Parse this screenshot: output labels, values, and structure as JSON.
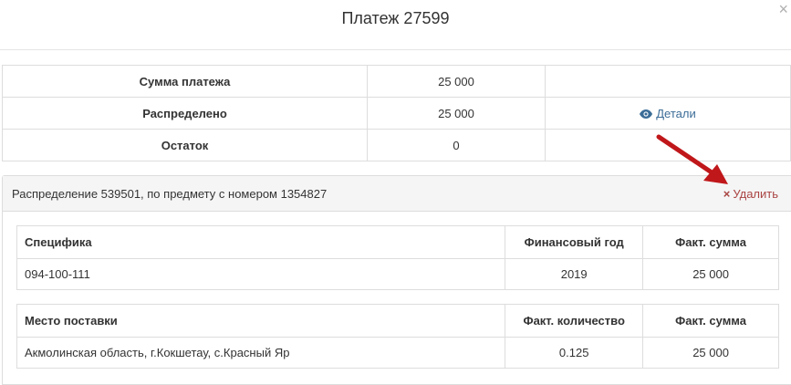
{
  "modal": {
    "title": "Платеж 27599",
    "close": "×"
  },
  "summary": {
    "rows": [
      {
        "label": "Сумма платежа",
        "value": "25 000",
        "extra": ""
      },
      {
        "label": "Распределено",
        "value": "25 000",
        "extra": "Детали"
      },
      {
        "label": "Остаток",
        "value": "0",
        "extra": ""
      }
    ]
  },
  "distribution": {
    "title": "Распределение 539501, по предмету с номером 1354827",
    "delete_label": "Удалить",
    "delete_icon": "×",
    "spec_table": {
      "headers": [
        "Специфика",
        "Финансовый год",
        "Факт. сумма"
      ],
      "rows": [
        [
          "094-100-111",
          "2019",
          "25 000"
        ]
      ]
    },
    "place_table": {
      "headers": [
        "Место поставки",
        "Факт. количество",
        "Факт. сумма"
      ],
      "rows": [
        [
          "Акмолинская область, г.Кокшетау, с.Красный Яр",
          "0.125",
          "25 000"
        ]
      ]
    }
  },
  "colors": {
    "link": "#3b6c97",
    "delete": "#a94442",
    "arrow": "#c0171a"
  }
}
